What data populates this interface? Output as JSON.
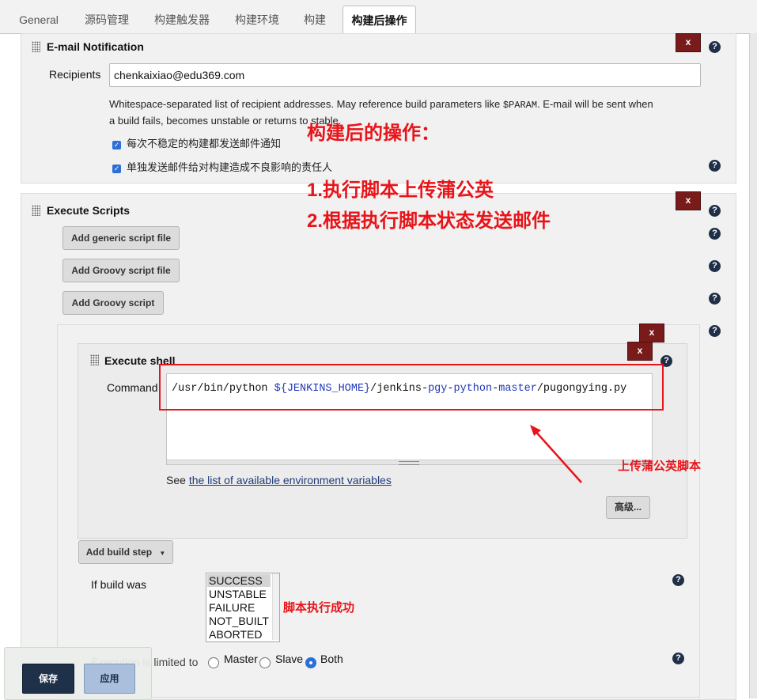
{
  "tabs": [
    {
      "label": "General",
      "active": false
    },
    {
      "label": "源码管理",
      "active": false
    },
    {
      "label": "构建触发器",
      "active": false
    },
    {
      "label": "构建环境",
      "active": false
    },
    {
      "label": "构建",
      "active": false
    },
    {
      "label": "构建后操作",
      "active": true
    }
  ],
  "email": {
    "title": "E-mail Notification",
    "delete_label": "x",
    "recipients_label": "Recipients",
    "recipients_value": "chenkaixiao@edu369.com",
    "help_line1_pre": "Whitespace-separated list of recipient addresses. May reference build parameters like ",
    "help_param": "$PARAM",
    "help_line1_post": ". E-mail will be sent when",
    "help_line2": "a build fails, becomes unstable or returns to stable.",
    "check1": "每次不稳定的构建都发送邮件通知",
    "check2": "单独发送邮件给对构建造成不良影响的责任人"
  },
  "scripts": {
    "title": "Execute Scripts",
    "delete_label": "x",
    "btn_generic": "Add generic script file",
    "btn_groovy_file": "Add Groovy script file",
    "btn_groovy": "Add Groovy script",
    "add_build_step": "Add build step",
    "if_build_was": "If build was",
    "statuses": [
      "SUCCESS",
      "UNSTABLE",
      "FAILURE",
      "NOT_BUILT",
      "ABORTED"
    ],
    "selected_status": "SUCCESS",
    "exec_limited": "Execution is limited to",
    "radio_options": [
      "Master",
      "Slave",
      "Both"
    ],
    "radio_selected": "Both"
  },
  "shell": {
    "title": "Execute shell",
    "command_label": "Command",
    "cmd_part1": "/usr/bin/python ",
    "cmd_var": "${JENKINS_HOME}",
    "cmd_part2": "/jenkins-",
    "cmd_part3": "pgy",
    "cmd_part4": "-",
    "cmd_part5": "python",
    "cmd_part6": "-",
    "cmd_part7": "master",
    "cmd_part8": "/pugongying.py",
    "see_text": "See ",
    "see_link": "the list of available environment variables",
    "advanced": "高级..."
  },
  "annotations": {
    "heading": "构建后的操作：",
    "step1": "1.执行脚本上传蒲公英",
    "step2": "2.根据执行脚本状态发送邮件",
    "upload_note": "上传蒲公英脚本",
    "success_note": "脚本执行成功"
  },
  "footer": {
    "save": "保存",
    "apply": "应用"
  },
  "help_glyph": "?",
  "colors": {
    "annotation_red": "#e8141a",
    "delete_button": "#7a1b1b",
    "save_button": "#1f3049",
    "apply_button": "#a9bfdc"
  }
}
